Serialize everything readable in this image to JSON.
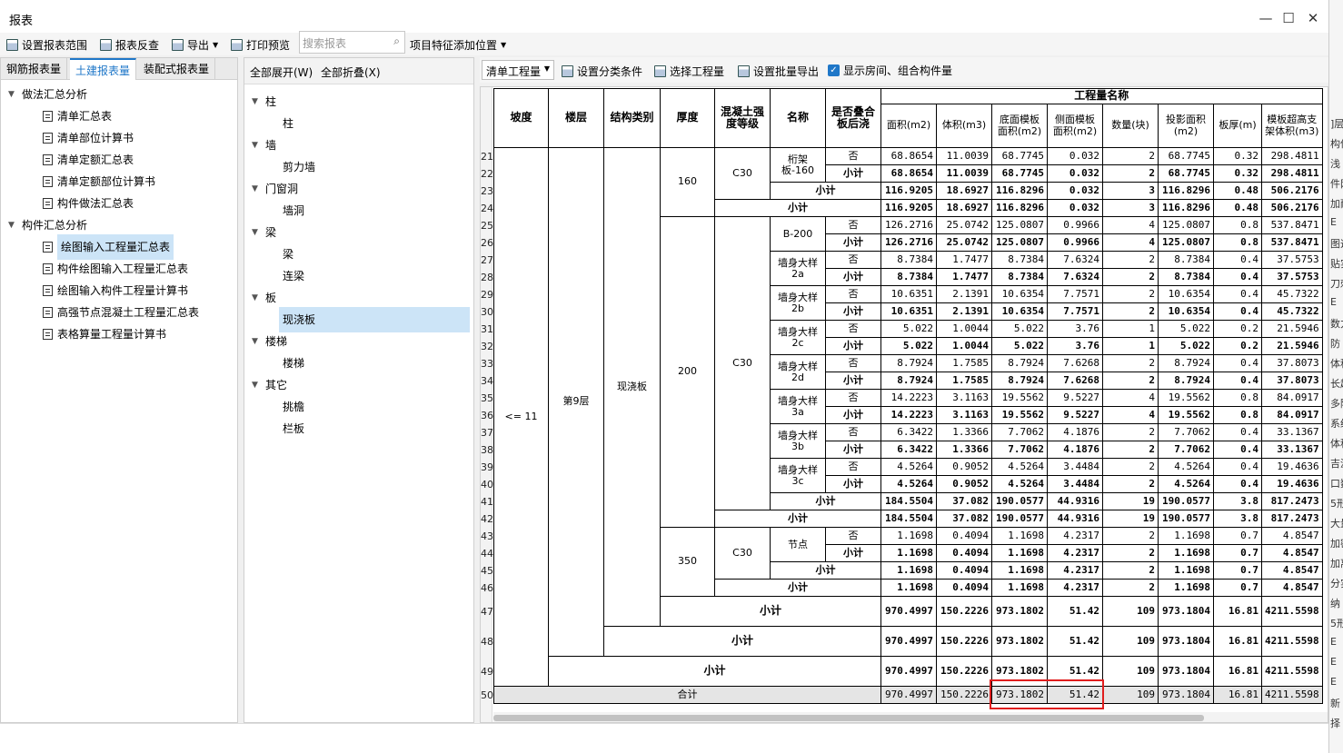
{
  "window": {
    "title": "报表",
    "min": "—",
    "max": "☐",
    "close": "✕"
  },
  "toolbar": {
    "set_range": "设置报表范围",
    "report_reverse": "报表反查",
    "export": "导出",
    "print_preview": "打印预览",
    "search_placeholder": "搜索报表",
    "item_feature": "项目特征添加位置"
  },
  "left": {
    "tabs": [
      "钢筋报表量",
      "土建报表量",
      "装配式报表量"
    ],
    "groups": [
      {
        "label": "做法汇总分析",
        "items": [
          "清单汇总表",
          "清单部位计算书",
          "清单定额汇总表",
          "清单定额部位计算书",
          "构件做法汇总表"
        ]
      },
      {
        "label": "构件汇总分析",
        "items": [
          "绘图输入工程量汇总表",
          "构件绘图输入工程量汇总表",
          "绘图输入构件工程量计算书",
          "高强节点混凝土工程量汇总表",
          "表格算量工程量计算书"
        ]
      }
    ]
  },
  "middle": {
    "expand_all": "全部展开(W)",
    "collapse_all": "全部折叠(X)",
    "tree": [
      {
        "label": "柱",
        "children": [
          "柱"
        ]
      },
      {
        "label": "墙",
        "children": [
          "剪力墙"
        ]
      },
      {
        "label": "门窗洞",
        "children": [
          "墙洞"
        ]
      },
      {
        "label": "梁",
        "children": [
          "梁",
          "连梁"
        ]
      },
      {
        "label": "板",
        "children": [
          "现浇板"
        ]
      },
      {
        "label": "楼梯",
        "children": [
          "楼梯"
        ]
      },
      {
        "label": "其它",
        "children": [
          "挑檐",
          "栏板"
        ]
      }
    ]
  },
  "right": {
    "select": "清单工程量",
    "set_category": "设置分类条件",
    "select_qty": "选择工程量",
    "batch_export": "设置批量导出",
    "show_room": "显示房间、组合构件量"
  },
  "table": {
    "headers": {
      "slope": "坡度",
      "floor": "楼层",
      "struct": "结构类别",
      "thickness": "厚度",
      "concrete": "混凝土强度等级",
      "name": "名称",
      "overlap": "是否叠合板后浇",
      "qty_name": "工程量名称",
      "cols": [
        "面积(m2)",
        "体积(m3)",
        "底面模板面积(m2)",
        "侧面模板面积(m2)",
        "数量(块)",
        "投影面积(m2)",
        "板厚(m)",
        "模板超高支架体积(m3)"
      ]
    },
    "row_numbers": [
      "21",
      "22",
      "23",
      "24",
      "25",
      "26",
      "27",
      "28",
      "29",
      "30",
      "31",
      "32",
      "33",
      "34",
      "35",
      "36",
      "37",
      "38",
      "39",
      "40",
      "41",
      "42",
      "43",
      "44",
      "45",
      "46",
      "47",
      "48",
      "49",
      "50"
    ],
    "slope": "<= 11",
    "floor": "第9层",
    "struct": "现浇板",
    "t160": "160",
    "t200": "200",
    "t350": "350",
    "c30": "C30",
    "no": "否",
    "subtotal": "小计",
    "total": "合计",
    "names": [
      "桁架板-160",
      "B-200",
      "墙身大样2a",
      "墙身大样2b",
      "墙身大样2c",
      "墙身大样2d",
      "墙身大样3a",
      "墙身大样3b",
      "墙身大样3c",
      "节点"
    ],
    "rows": [
      [
        "68.8654",
        "11.0039",
        "68.7745",
        "0.032",
        "2",
        "68.7745",
        "0.32",
        "298.4811"
      ],
      [
        "68.8654",
        "11.0039",
        "68.7745",
        "0.032",
        "2",
        "68.7745",
        "0.32",
        "298.4811"
      ],
      [
        "116.9205",
        "18.6927",
        "116.8296",
        "0.032",
        "3",
        "116.8296",
        "0.48",
        "506.2176"
      ],
      [
        "116.9205",
        "18.6927",
        "116.8296",
        "0.032",
        "3",
        "116.8296",
        "0.48",
        "506.2176"
      ],
      [
        "126.2716",
        "25.0742",
        "125.0807",
        "0.9966",
        "4",
        "125.0807",
        "0.8",
        "537.8471"
      ],
      [
        "126.2716",
        "25.0742",
        "125.0807",
        "0.9966",
        "4",
        "125.0807",
        "0.8",
        "537.8471"
      ],
      [
        "8.7384",
        "1.7477",
        "8.7384",
        "7.6324",
        "2",
        "8.7384",
        "0.4",
        "37.5753"
      ],
      [
        "8.7384",
        "1.7477",
        "8.7384",
        "7.6324",
        "2",
        "8.7384",
        "0.4",
        "37.5753"
      ],
      [
        "10.6351",
        "2.1391",
        "10.6354",
        "7.7571",
        "2",
        "10.6354",
        "0.4",
        "45.7322"
      ],
      [
        "10.6351",
        "2.1391",
        "10.6354",
        "7.7571",
        "2",
        "10.6354",
        "0.4",
        "45.7322"
      ],
      [
        "5.022",
        "1.0044",
        "5.022",
        "3.76",
        "1",
        "5.022",
        "0.2",
        "21.5946"
      ],
      [
        "5.022",
        "1.0044",
        "5.022",
        "3.76",
        "1",
        "5.022",
        "0.2",
        "21.5946"
      ],
      [
        "8.7924",
        "1.7585",
        "8.7924",
        "7.6268",
        "2",
        "8.7924",
        "0.4",
        "37.8073"
      ],
      [
        "8.7924",
        "1.7585",
        "8.7924",
        "7.6268",
        "2",
        "8.7924",
        "0.4",
        "37.8073"
      ],
      [
        "14.2223",
        "3.1163",
        "19.5562",
        "9.5227",
        "4",
        "19.5562",
        "0.8",
        "84.0917"
      ],
      [
        "14.2223",
        "3.1163",
        "19.5562",
        "9.5227",
        "4",
        "19.5562",
        "0.8",
        "84.0917"
      ],
      [
        "6.3422",
        "1.3366",
        "7.7062",
        "4.1876",
        "2",
        "7.7062",
        "0.4",
        "33.1367"
      ],
      [
        "6.3422",
        "1.3366",
        "7.7062",
        "4.1876",
        "2",
        "7.7062",
        "0.4",
        "33.1367"
      ],
      [
        "4.5264",
        "0.9052",
        "4.5264",
        "3.4484",
        "2",
        "4.5264",
        "0.4",
        "19.4636"
      ],
      [
        "4.5264",
        "0.9052",
        "4.5264",
        "3.4484",
        "2",
        "4.5264",
        "0.4",
        "19.4636"
      ],
      [
        "184.5504",
        "37.082",
        "190.0577",
        "44.9316",
        "19",
        "190.0577",
        "3.8",
        "817.2473"
      ],
      [
        "184.5504",
        "37.082",
        "190.0577",
        "44.9316",
        "19",
        "190.0577",
        "3.8",
        "817.2473"
      ],
      [
        "1.1698",
        "0.4094",
        "1.1698",
        "4.2317",
        "2",
        "1.1698",
        "0.7",
        "4.8547"
      ],
      [
        "1.1698",
        "0.4094",
        "1.1698",
        "4.2317",
        "2",
        "1.1698",
        "0.7",
        "4.8547"
      ],
      [
        "1.1698",
        "0.4094",
        "1.1698",
        "4.2317",
        "2",
        "1.1698",
        "0.7",
        "4.8547"
      ],
      [
        "1.1698",
        "0.4094",
        "1.1698",
        "4.2317",
        "2",
        "1.1698",
        "0.7",
        "4.8547"
      ],
      [
        "970.4997",
        "150.2226",
        "973.1802",
        "51.42",
        "109",
        "973.1804",
        "16.81",
        "4211.5598"
      ],
      [
        "970.4997",
        "150.2226",
        "973.1802",
        "51.42",
        "109",
        "973.1804",
        "16.81",
        "4211.5598"
      ],
      [
        "970.4997",
        "150.2226",
        "973.1802",
        "51.42",
        "109",
        "973.1804",
        "16.81",
        "4211.5598"
      ],
      [
        "970.4997",
        "150.2226",
        "973.1802",
        "51.42",
        "109",
        "973.1804",
        "16.81",
        "4211.5598"
      ]
    ]
  },
  "right_strip": [
    "]层",
    "构件",
    "浅",
    "件网",
    "加耐",
    "E",
    "图造",
    "贴实",
    "刀刺",
    "E",
    "数力",
    "防",
    "体积",
    "长超",
    "多除",
    "系统",
    "体积",
    "吉源",
    "口数",
    "5形",
    "大量",
    "加密",
    "加离",
    "分实",
    "纳",
    "5形",
    "E",
    "E",
    "E",
    "新",
    "择"
  ]
}
